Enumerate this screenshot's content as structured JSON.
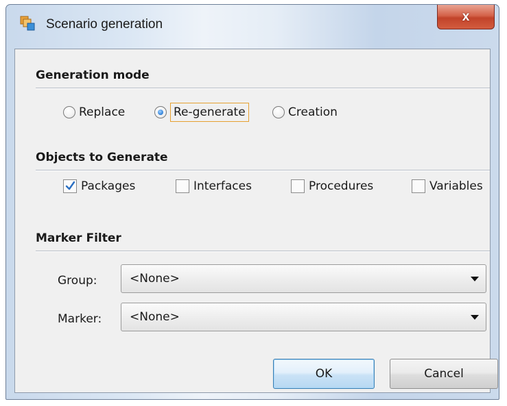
{
  "window": {
    "title": "Scenario generation",
    "close_label": "x"
  },
  "generation_mode": {
    "heading": "Generation mode",
    "options": [
      {
        "label": "Replace",
        "selected": false
      },
      {
        "label": "Re-generate",
        "selected": true
      },
      {
        "label": "Creation",
        "selected": false
      }
    ]
  },
  "objects": {
    "heading": "Objects to Generate",
    "items": [
      {
        "label": "Packages",
        "checked": true
      },
      {
        "label": "Interfaces",
        "checked": false
      },
      {
        "label": "Procedures",
        "checked": false
      },
      {
        "label": "Variables",
        "checked": false
      }
    ]
  },
  "marker_filter": {
    "heading": "Marker Filter",
    "group_label": "Group:",
    "group_value": "<None>",
    "marker_label": "Marker:",
    "marker_value": "<None>"
  },
  "buttons": {
    "ok": "OK",
    "cancel": "Cancel"
  },
  "icons": {
    "app": "scenario-icon",
    "close": "close-icon",
    "dropdown": "chevron-down-icon",
    "check": "checkmark-icon"
  },
  "colors": {
    "accent": "#3c7fb1",
    "focus": "#e6a030",
    "close": "#c2432a"
  }
}
